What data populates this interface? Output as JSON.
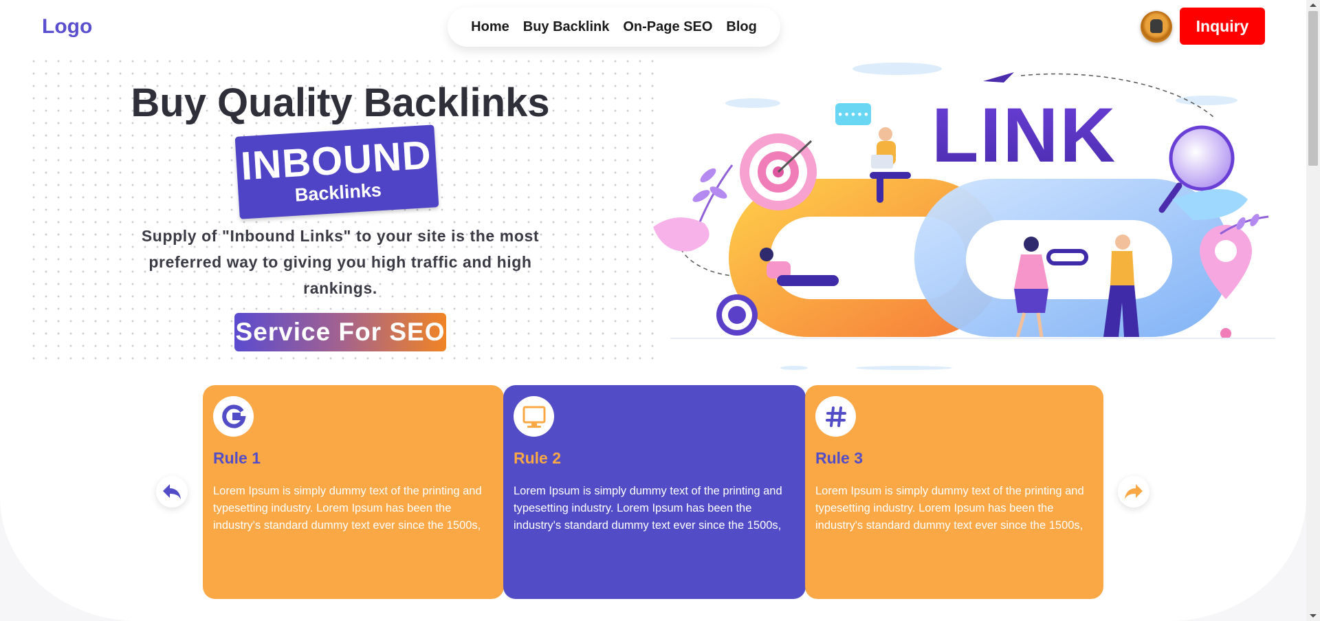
{
  "header": {
    "logo": "Logo",
    "nav": [
      {
        "label": "Home"
      },
      {
        "label": "Buy Backlink"
      },
      {
        "label": "On-Page SEO"
      },
      {
        "label": "Blog"
      }
    ],
    "inquiry_label": "Inquiry"
  },
  "hero": {
    "title": "Buy Quality Backlinks",
    "badge_main": "INBOUND",
    "badge_sub": "Backlinks",
    "description": "Supply of \"Inbound Links\" to your site is the most preferred way to giving you high traffic and high rankings.",
    "service_label": "Service For SEO",
    "illustration_text": "LINK"
  },
  "cards": [
    {
      "title": "Rule 1",
      "text": "Lorem Ipsum is simply dummy text of the printing and typesetting industry. Lorem Ipsum has been the industry's standard dummy text ever since the 1500s,",
      "icon": "google-icon",
      "color": "#faa846"
    },
    {
      "title": "Rule 2",
      "text": "Lorem Ipsum is simply dummy text of the printing and typesetting industry. Lorem Ipsum has been the industry's standard dummy text ever since the 1500s,",
      "icon": "monitor-icon",
      "color": "#524dc6"
    },
    {
      "title": "Rule 3",
      "text": "Lorem Ipsum is simply dummy text of the printing and typesetting industry. Lorem Ipsum has been the industry's standard dummy text ever since the 1500s,",
      "icon": "hashtag-icon",
      "color": "#faa846"
    }
  ],
  "colors": {
    "brand_purple": "#524dc6",
    "brand_orange": "#faa846",
    "inquiry_red": "#ff0000"
  }
}
